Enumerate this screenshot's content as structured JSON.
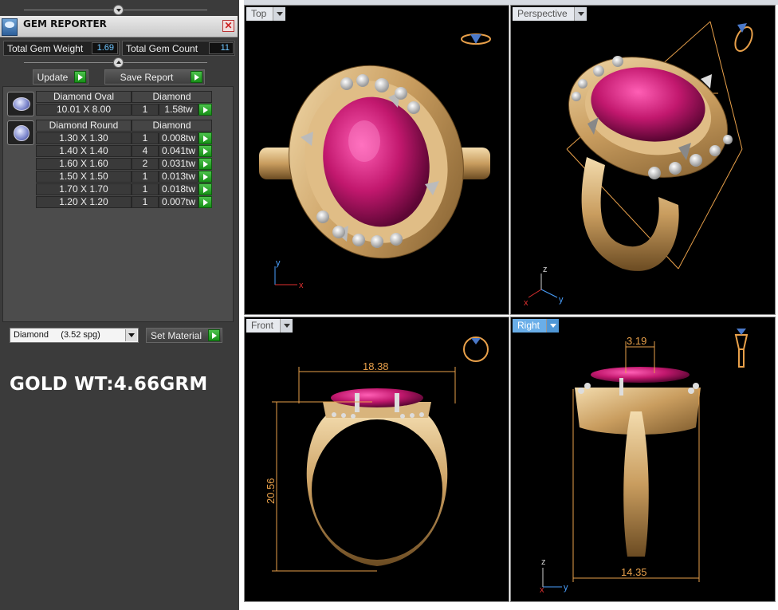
{
  "panel": {
    "title": "GEM REPORTER",
    "close_label": "✕",
    "total_weight_label": "Total Gem Weight",
    "total_weight_value": "1.69",
    "total_count_label": "Total Gem Count",
    "total_count_value": "11",
    "update_label": "Update",
    "save_report_label": "Save Report"
  },
  "gem_groups": [
    {
      "shape": "Diamond Oval",
      "material": "Diamond",
      "rows": [
        {
          "size": "10.01 X 8.00",
          "count": "1",
          "weight": "1.58tw"
        }
      ]
    },
    {
      "shape": "Diamond Round",
      "material": "Diamond",
      "rows": [
        {
          "size": "1.30 X 1.30",
          "count": "1",
          "weight": "0.008tw"
        },
        {
          "size": "1.40 X 1.40",
          "count": "4",
          "weight": "0.041tw"
        },
        {
          "size": "1.60 X 1.60",
          "count": "2",
          "weight": "0.031tw"
        },
        {
          "size": "1.50 X 1.50",
          "count": "1",
          "weight": "0.013tw"
        },
        {
          "size": "1.70 X 1.70",
          "count": "1",
          "weight": "0.018tw"
        },
        {
          "size": "1.20 X 1.20",
          "count": "1",
          "weight": "0.007tw"
        }
      ]
    }
  ],
  "material_select": {
    "value": "Diamond     (3.52 spg)",
    "button_label": "Set Material"
  },
  "annotation": "GOLD WT:4.66GRM",
  "viewports": {
    "top": {
      "label": "Top"
    },
    "perspective": {
      "label": "Perspective"
    },
    "front": {
      "label": "Front",
      "width_dim": "18.38",
      "height_dim": "20.56"
    },
    "right": {
      "label": "Right",
      "top_dim": "3.19",
      "bottom_dim": "14.35"
    }
  },
  "axes": {
    "x": "x",
    "y": "y",
    "z": "z"
  },
  "colors": {
    "panel_bg": "#3b3b3b",
    "viewport_bg": "#000000",
    "gold": "#d4b07a",
    "ruby": "#c2186e",
    "dimension": "#e8a04a",
    "active_tab": "#6aaee8",
    "play_button": "#2fae2f"
  }
}
